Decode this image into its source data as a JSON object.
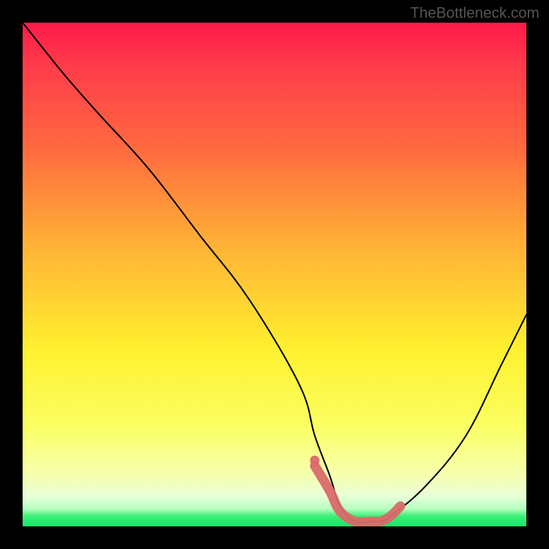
{
  "watermark": "TheBottleneck.com",
  "chart_data": {
    "type": "line",
    "title": "",
    "xlabel": "",
    "ylabel": "",
    "xlim": [
      0,
      100
    ],
    "ylim": [
      0,
      100
    ],
    "series": [
      {
        "name": "bottleneck-curve",
        "x": [
          0,
          8,
          15,
          25,
          35,
          45,
          55,
          58,
          61,
          63,
          66,
          69,
          71,
          73,
          80,
          88,
          95,
          100
        ],
        "values": [
          100,
          90,
          82,
          71,
          58,
          45,
          28,
          18,
          10,
          4,
          1,
          1,
          1,
          2,
          8,
          18,
          32,
          42
        ]
      }
    ],
    "markers": {
      "name": "highlight-segment",
      "color": "#d96a6a",
      "points": [
        {
          "x": 58,
          "y": 12
        },
        {
          "x": 61,
          "y": 7
        },
        {
          "x": 63,
          "y": 3
        },
        {
          "x": 66,
          "y": 1
        },
        {
          "x": 69,
          "y": 1
        },
        {
          "x": 71,
          "y": 1
        },
        {
          "x": 73,
          "y": 2
        },
        {
          "x": 75,
          "y": 4
        }
      ]
    },
    "gradient_stops": [
      {
        "pos": 0,
        "color": "#ff1a4a"
      },
      {
        "pos": 0.45,
        "color": "#ffb436"
      },
      {
        "pos": 0.7,
        "color": "#fff12f"
      },
      {
        "pos": 0.95,
        "color": "#e8ffd8"
      },
      {
        "pos": 1.0,
        "color": "#18e56b"
      }
    ]
  }
}
